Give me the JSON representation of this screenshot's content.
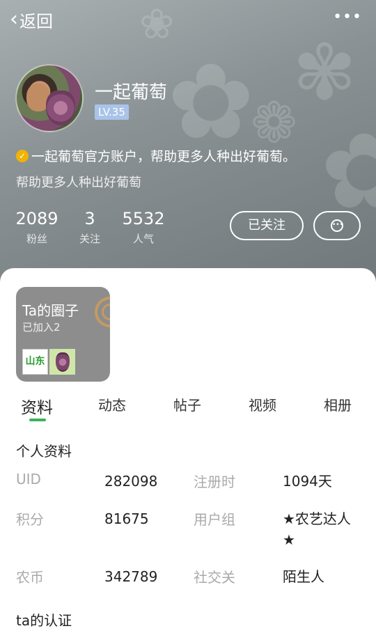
{
  "nav": {
    "back_label": "返回",
    "more_label": "•••"
  },
  "profile": {
    "username": "一起葡萄",
    "level": "LV.35",
    "verified_text": "一起葡萄官方账户，帮助更多人种出好葡萄。",
    "bio": "帮助更多人种出好葡萄",
    "stats": [
      {
        "value": "2089",
        "label": "粉丝"
      },
      {
        "value": "3",
        "label": "关注"
      },
      {
        "value": "5532",
        "label": "人气"
      }
    ],
    "follow_button": "已关注",
    "message_button_icon": "chat-bubble-icon"
  },
  "circle": {
    "title": "Ta的圈子",
    "subtitle": "已加入2",
    "tags": [
      "山东",
      "grape-image"
    ]
  },
  "tabs": [
    {
      "label": "资料",
      "active": true
    },
    {
      "label": "动态",
      "active": false
    },
    {
      "label": "帖子",
      "active": false
    },
    {
      "label": "视频",
      "active": false
    },
    {
      "label": "相册",
      "active": false
    }
  ],
  "info": {
    "section_title": "个人资料",
    "rows": [
      {
        "label1": "UID",
        "value1": "282098",
        "label2": "注册时",
        "value2": "1094天"
      },
      {
        "label1": "积分",
        "value1": "81675",
        "label2": "用户组",
        "value2": "★农艺达人★"
      },
      {
        "label1": "农币",
        "value1": "342789",
        "label2": "社交关",
        "value2": "陌生人"
      }
    ]
  },
  "certification": {
    "section_title": "ta的认证"
  },
  "colors": {
    "accent": "#3cb25a",
    "level_badge": "#a9c4e8",
    "verified_badge": "#f0b400"
  }
}
